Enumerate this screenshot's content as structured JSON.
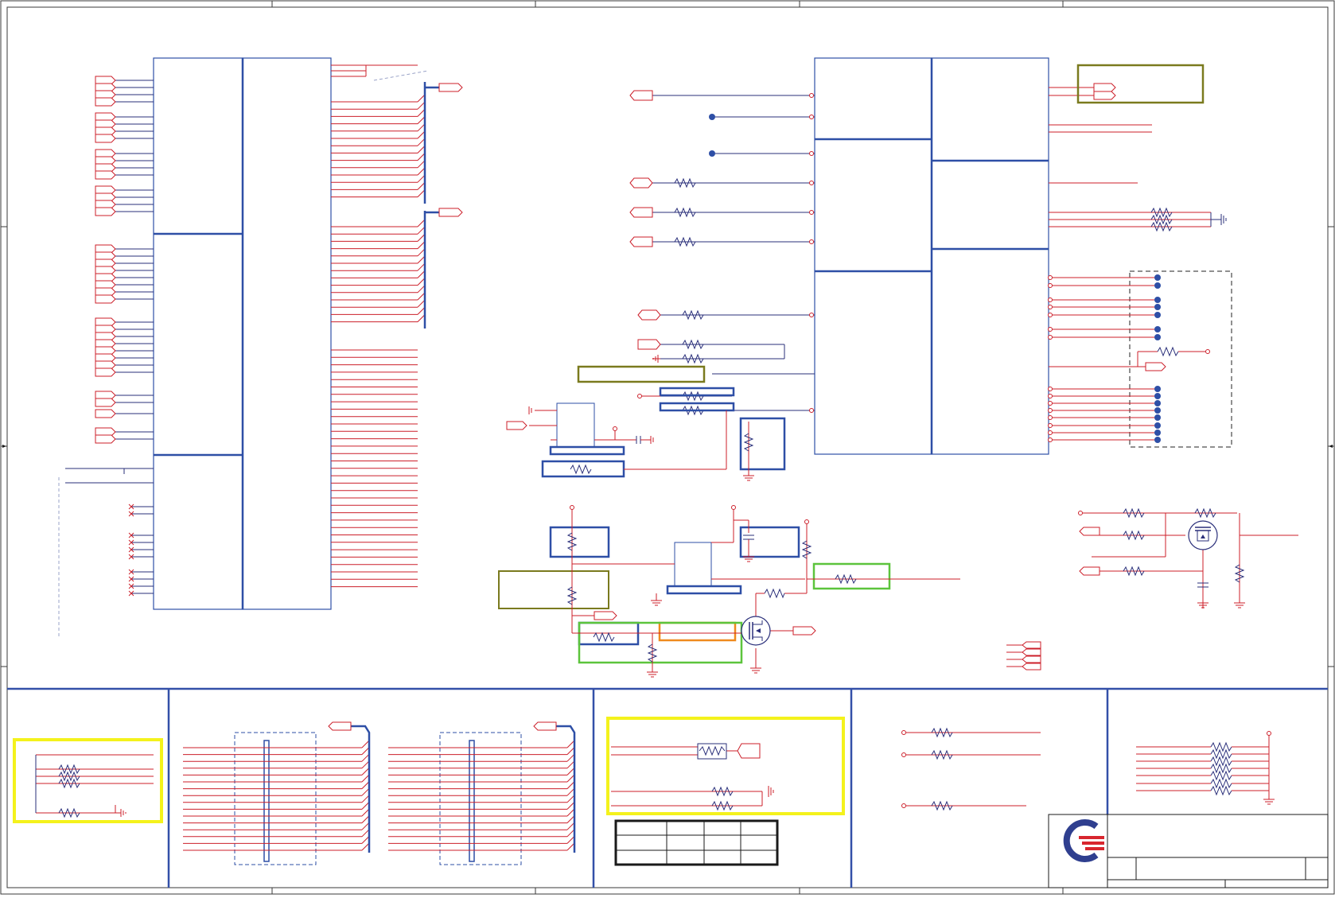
{
  "colors": {
    "wire": "#cc1f2a",
    "net": "#2a2f7a",
    "block": "#2e4fa6",
    "frame": "#3350a8",
    "olive_box": "#7a7a1e",
    "green_box": "#5cc43c",
    "orange_box": "#ef8a1e",
    "yellow_box": "#f4f21c",
    "junction": "#2e4fa6"
  },
  "icons": {
    "logo": "company-logo-icon",
    "transistor": "mosfet-icon",
    "ground": "ground-symbol-icon",
    "resistor": "resistor-icon",
    "capacitor": "capacitor-icon",
    "connector": "off-page-connector-icon"
  }
}
